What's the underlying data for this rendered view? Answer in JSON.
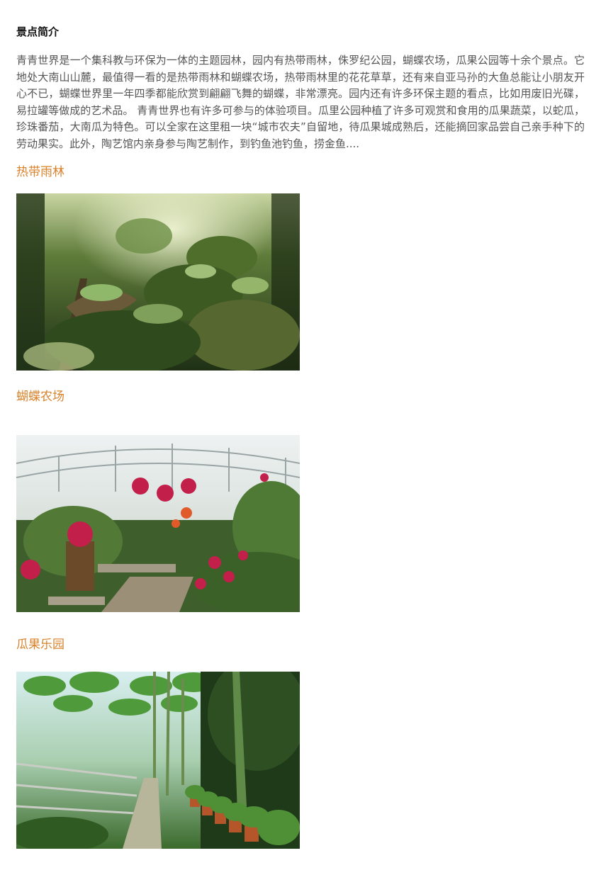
{
  "article": {
    "section_title": "景点简介",
    "intro": "青青世界是一个集科教与环保为一体的主题园林，园内有热带雨林，侏罗纪公园，蝴蝶农场，瓜果公园等十余个景点。它地处大南山山麓，最值得一看的是热带雨林和蝴蝶农场，热带雨林里的花花草草，还有来自亚马孙的大鱼总能让小朋友开心不已，蝴蝶世界里一年四季都能欣赏到翩翩飞舞的蝴蝶，非常漂亮。园内还有许多环保主题的看点，比如用废旧光碟，易拉罐等做成的艺术品。 青青世界也有许多可参与的体验项目。瓜里公园种植了许多可观赏和食用的瓜果蔬菜，以蛇瓜，珍珠番茄，大南瓜为特色。可以全家在这里租一块“城市农夫”自留地，待瓜果城成熟后，还能摘回家品尝自己亲手种下的劳动果实。此外，陶艺馆内亲身参与陶艺制作，到钓鱼池钓鱼，捞金鱼....",
    "spots": [
      {
        "title": "热带雨林"
      },
      {
        "title": "蝴蝶农场"
      },
      {
        "title": "瓜果乐园"
      }
    ]
  },
  "colors": {
    "heading_accent": "#d9822b",
    "body_text": "#555555",
    "title_text": "#111111"
  }
}
